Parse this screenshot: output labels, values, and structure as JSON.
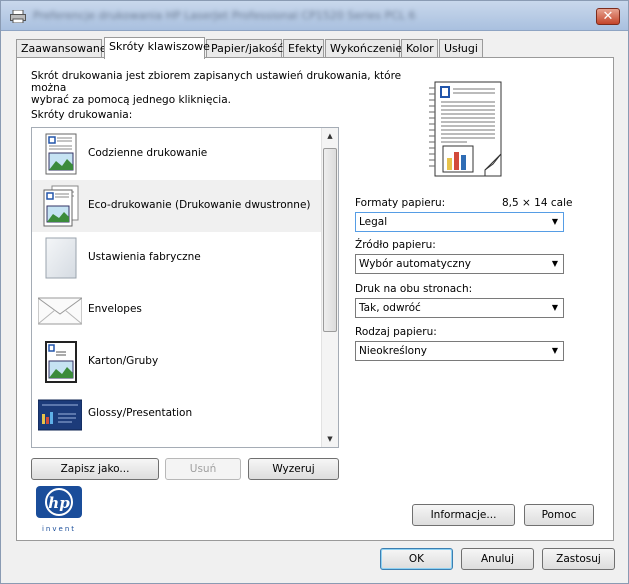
{
  "window": {
    "title": "Preferencje drukowania HP LaserJet Professional CP1520 Series PCL 6",
    "close_label": "✕"
  },
  "tabs": [
    {
      "label": "Zaawansowane"
    },
    {
      "label": "Skróty klawiszowe"
    },
    {
      "label": "Papier/jakość"
    },
    {
      "label": "Efekty"
    },
    {
      "label": "Wykończenie"
    },
    {
      "label": "Kolor"
    },
    {
      "label": "Usługi"
    }
  ],
  "panel": {
    "description_line1": "Skrót drukowania jest zbiorem zapisanych ustawień drukowania, które można",
    "description_line2": "wybrać za pomocą jednego kliknięcia.",
    "list_label": "Skróty drukowania:",
    "shortcuts": [
      {
        "label": "Codzienne drukowanie",
        "icon": "document-image-icon"
      },
      {
        "label": "Eco-drukowanie (Drukowanie dwustronne)",
        "icon": "duplex-document-icon"
      },
      {
        "label": "Ustawienia fabryczne",
        "icon": "blank-page-icon"
      },
      {
        "label": "Envelopes",
        "icon": "envelope-icon"
      },
      {
        "label": "Karton/Gruby",
        "icon": "cardstock-icon"
      },
      {
        "label": "Glossy/Presentation",
        "icon": "presentation-icon"
      }
    ],
    "selected_index": 1,
    "save_as_label": "Zapisz jako...",
    "delete_label": "Usuń",
    "reset_label": "Wyzeruj",
    "paper_sizes_label": "Formaty papieru:",
    "paper_size_dimensions": "8,5 × 14 cale",
    "paper_size_value": "Legal",
    "paper_source_label": "Źródło papieru:",
    "paper_source_value": "Wybór automatyczny",
    "duplex_label": "Druk na obu stronach:",
    "duplex_value": "Tak, odwróć",
    "paper_type_label": "Rodzaj papieru:",
    "paper_type_value": "Nieokreślony",
    "info_label": "Informacje...",
    "help_label": "Pomoc",
    "logo_text": "invent"
  },
  "footer": {
    "ok_label": "OK",
    "cancel_label": "Anuluj",
    "apply_label": "Zastosuj"
  },
  "colors": {
    "accent": "#3c7fb1",
    "hp_blue": "#1a4d9a",
    "close_red": "#c4452a"
  }
}
